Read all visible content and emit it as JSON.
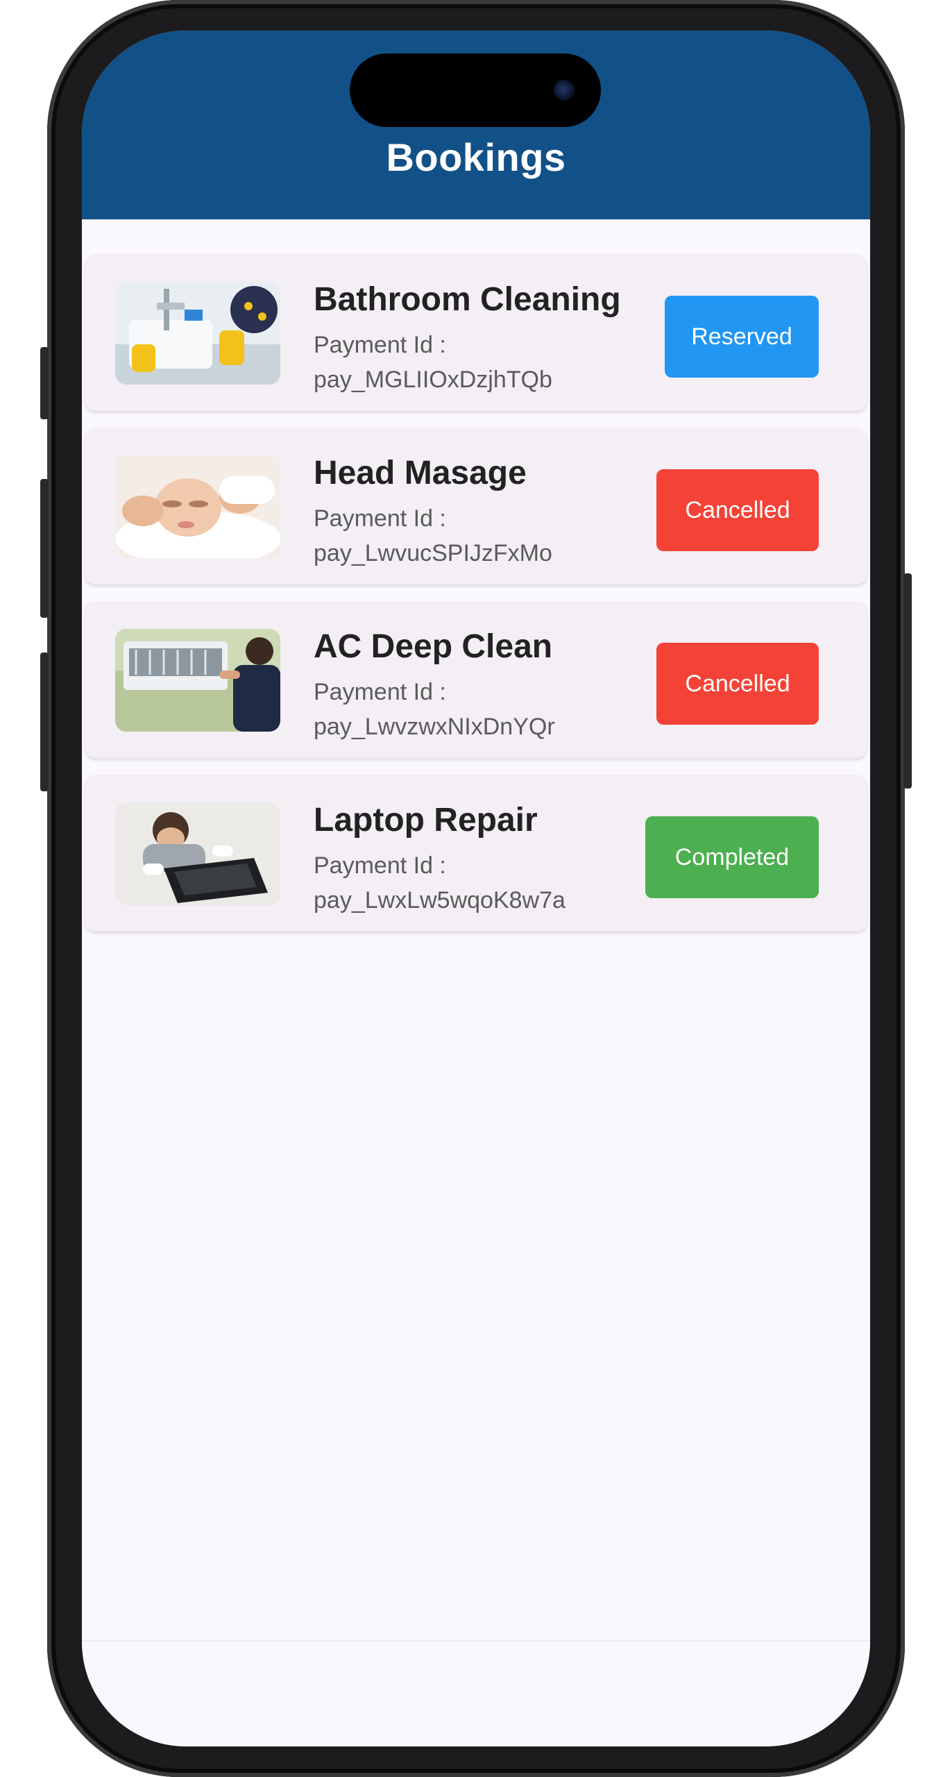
{
  "header": {
    "title": "Bookings"
  },
  "bookings": [
    {
      "title": "Bathroom Cleaning",
      "payment_label": "Payment Id :",
      "payment_id": "pay_MGLIIOxDzjhTQb",
      "status": "Reserved",
      "status_color": "#2196f3",
      "image": "bathroom-cleaning-photo"
    },
    {
      "title": "Head Masage",
      "payment_label": "Payment Id :",
      "payment_id": "pay_LwvucSPIJzFxMo",
      "status": "Cancelled",
      "status_color": "#f44336",
      "image": "head-massage-photo"
    },
    {
      "title": "AC Deep Clean",
      "payment_label": "Payment Id :",
      "payment_id": "pay_LwvzwxNIxDnYQr",
      "status": "Cancelled",
      "status_color": "#f44336",
      "image": "ac-deep-clean-photo"
    },
    {
      "title": "Laptop Repair",
      "payment_label": "Payment Id :",
      "payment_id": "pay_LwxLw5wqoK8w7a",
      "status": "Completed",
      "status_color": "#4caf50",
      "image": "laptop-repair-photo"
    }
  ],
  "colors": {
    "app_bar": "#115188",
    "background": "#fbf8fd",
    "card": "#f3eff5"
  }
}
